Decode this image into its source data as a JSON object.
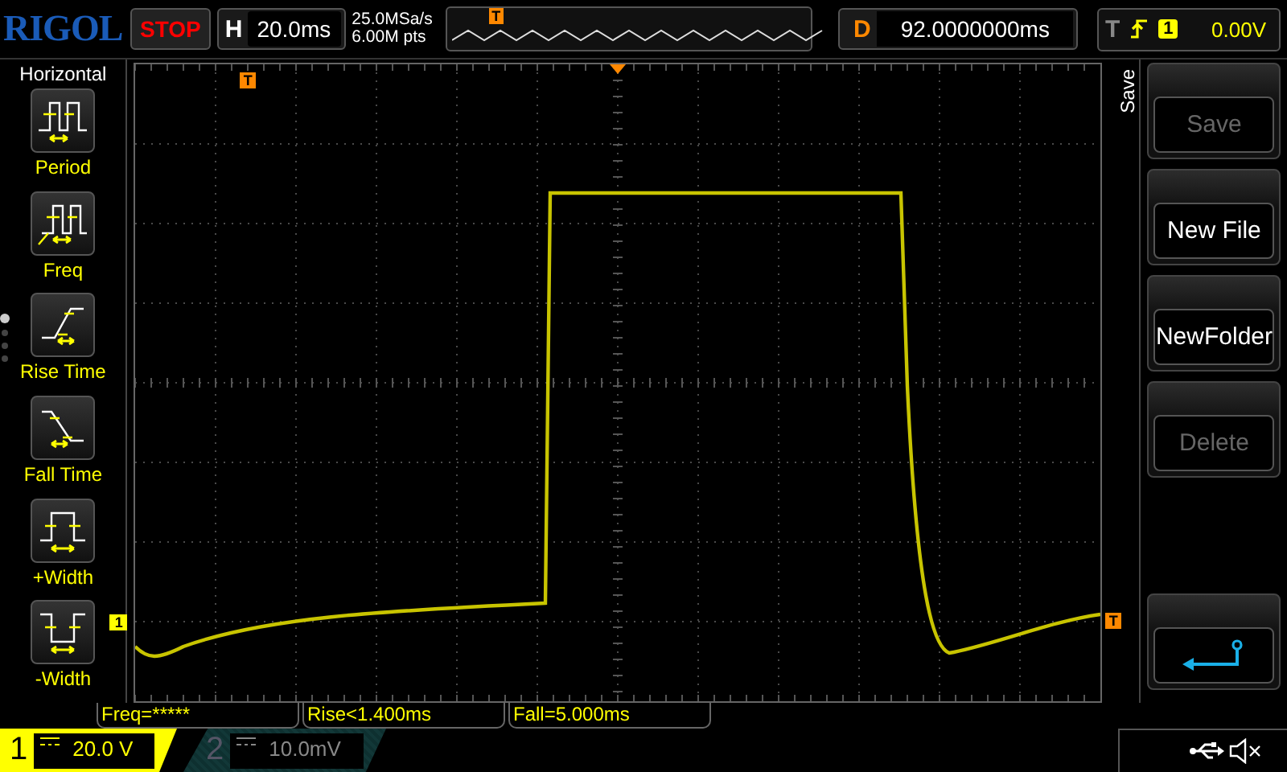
{
  "brand": {
    "logo": "RIGOL"
  },
  "run_state": {
    "label": "STOP"
  },
  "timebase": {
    "label": "H",
    "value": "20.0ms"
  },
  "acquisition": {
    "sample_rate": "25.0MSa/s",
    "memory_depth": "6.00M pts"
  },
  "overview": {
    "trigger_mark": "T"
  },
  "delay": {
    "label": "D",
    "value": "92.0000000ms"
  },
  "trigger": {
    "label": "T",
    "channel": "1",
    "level": "0.00V"
  },
  "left_menu": {
    "title": "Horizontal",
    "pages": [
      {
        "selected": true
      },
      {
        "selected": false
      },
      {
        "selected": false
      },
      {
        "selected": false
      }
    ],
    "items": [
      {
        "kind": "period",
        "label": "Period"
      },
      {
        "kind": "freq",
        "label": "Freq"
      },
      {
        "kind": "rise",
        "label": "Rise Time"
      },
      {
        "kind": "fall",
        "label": "Fall Time"
      },
      {
        "kind": "pwidth",
        "label": "+Width"
      },
      {
        "kind": "nwidth",
        "label": "-Width"
      }
    ]
  },
  "plot": {
    "trigger_position_mark": "T",
    "channel_mark": "1",
    "trigger_level_mark": "T"
  },
  "right_menu": {
    "title": "Save",
    "buttons": [
      {
        "kind": "text",
        "label": "Save",
        "disabled": true
      },
      {
        "kind": "text",
        "label": "New File",
        "disabled": false
      },
      {
        "kind": "text",
        "label": "NewFolder",
        "disabled": false
      },
      {
        "kind": "text",
        "label": "Delete",
        "disabled": true
      },
      {
        "kind": "empty"
      },
      {
        "kind": "back"
      }
    ]
  },
  "measurements": [
    "Freq=*****",
    "Rise<1.400ms",
    "Fall=5.000ms"
  ],
  "channels": [
    {
      "number": "1",
      "value": "20.0 V",
      "on": true
    },
    {
      "number": "2",
      "value": "10.0mV",
      "on": false
    }
  ]
}
